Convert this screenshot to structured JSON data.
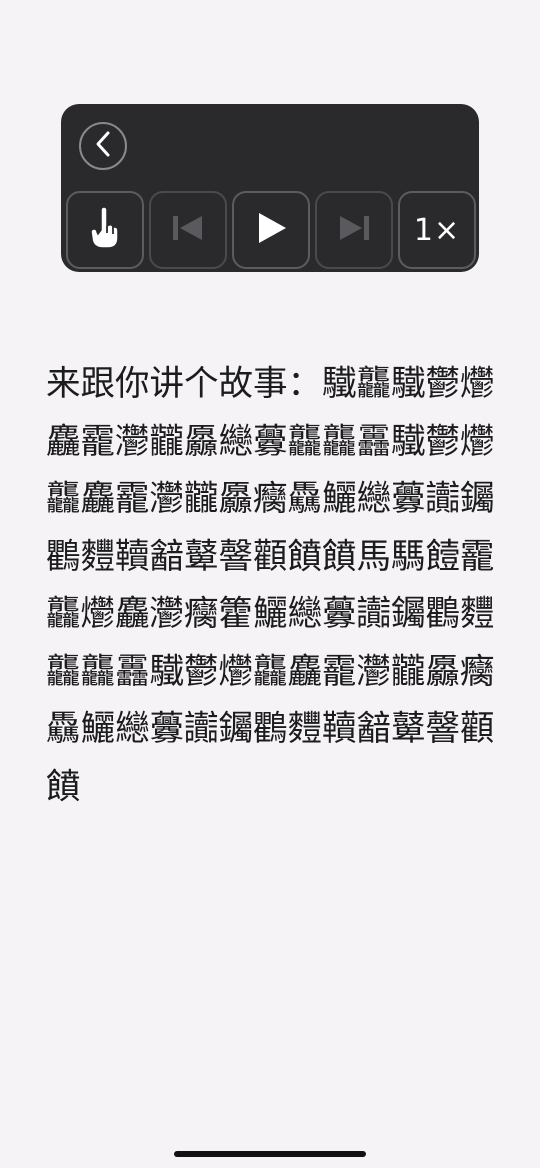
{
  "player": {
    "back_icon": "chevron-left-icon",
    "controls": [
      {
        "name": "tap-mode",
        "icon": "pointing-hand-icon",
        "enabled": true
      },
      {
        "name": "previous",
        "icon": "skip-back-icon",
        "enabled": false
      },
      {
        "name": "play",
        "icon": "play-icon",
        "enabled": true
      },
      {
        "name": "next",
        "icon": "skip-forward-icon",
        "enabled": false
      }
    ],
    "speed_label": "1×"
  },
  "story": {
    "text": "来跟你讲个故事：驖龘驖鬱爩麤靇灪龖厵纞虋龘龘靐驖鬱爩龘麤靇灪龖厵癵驫鱺纞虋讟钃鸜麷韇韽鼙韾顴饙饙馬騳饐靇龘爩麤灪癵籗鱺纞虋讟钃鸜麷龘龘靐驖鬱爩龘麤靇灪龖厵癵驫鱺纞虋讟钃鸜麷韇韽鼙韾顴饙"
  },
  "colors": {
    "page_background": "#f6f3f7",
    "card_background": "#2a2a2c",
    "control_border": "#5c5c60",
    "icon_enabled": "#ffffff",
    "icon_disabled": "#5a5a5e",
    "text": "#1c1c1e"
  }
}
